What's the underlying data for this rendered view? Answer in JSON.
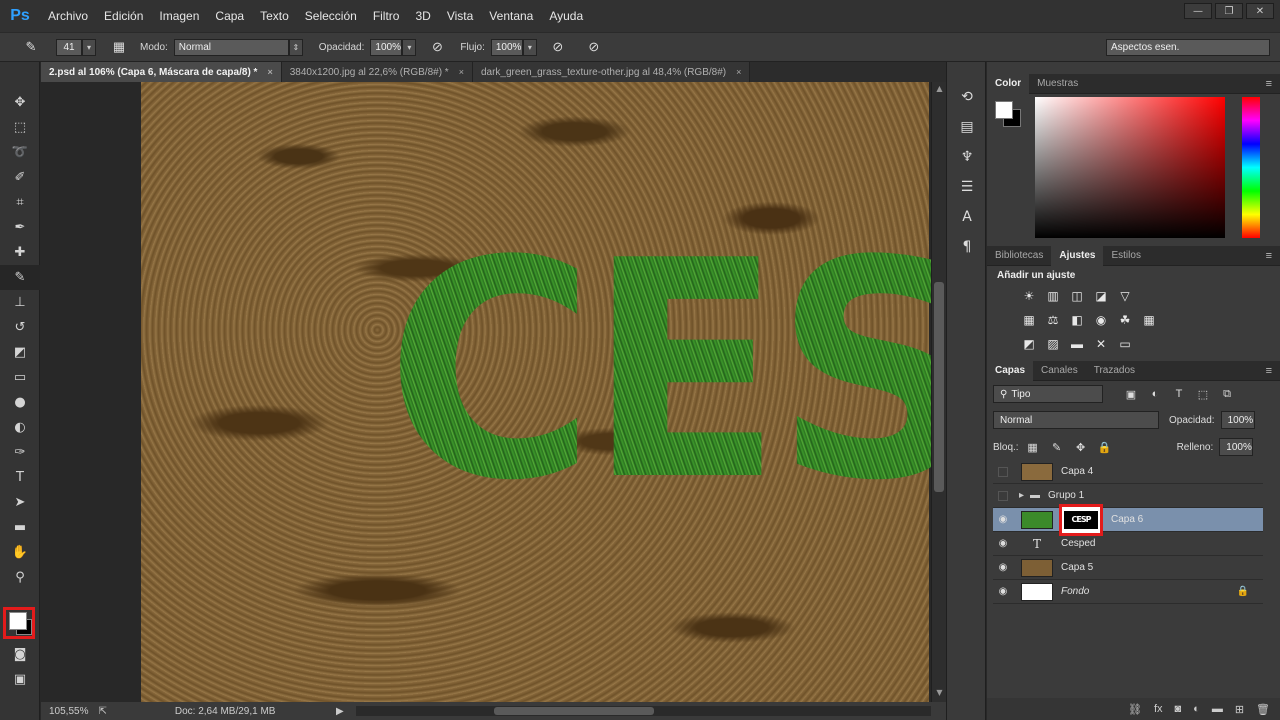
{
  "app": {
    "logo": "Ps"
  },
  "menu": [
    "Archivo",
    "Edición",
    "Imagen",
    "Capa",
    "Texto",
    "Selección",
    "Filtro",
    "3D",
    "Vista",
    "Ventana",
    "Ayuda"
  ],
  "window_controls": {
    "minimize": "—",
    "restore": "❐",
    "close": "✕"
  },
  "options_bar": {
    "brush_size": "41",
    "mode_label": "Modo:",
    "mode_value": "Normal",
    "opacity_label": "Opacidad:",
    "opacity_value": "100%",
    "flow_label": "Flujo:",
    "flow_value": "100%",
    "workspace": "Aspectos esen."
  },
  "doc_tabs": [
    {
      "label": "2.psd al 106% (Capa 6, Máscara de capa/8) *",
      "close": "×"
    },
    {
      "label": "3840x1200.jpg al 22,6% (RGB/8#) *",
      "close": "×"
    },
    {
      "label": "dark_green_grass_texture-other.jpg al 48,4% (RGB/8#)",
      "close": "×"
    }
  ],
  "canvas": {
    "text": "CESP"
  },
  "status": {
    "zoom": "105,55%",
    "doc_info": "Doc: 2,64 MB/29,1 MB"
  },
  "color_panel": {
    "tabs": [
      "Color",
      "Muestras"
    ]
  },
  "adjust_panel": {
    "tabs": [
      "Bibliotecas",
      "Ajustes",
      "Estilos"
    ],
    "title": "Añadir un ajuste"
  },
  "layers_panel": {
    "tabs": [
      "Capas",
      "Canales",
      "Trazados"
    ],
    "filter": "Tipo",
    "blend_mode": "Normal",
    "opacity_label": "Opacidad:",
    "opacity_value": "100%",
    "lock_label": "Bloq.:",
    "fill_label": "Relleno:",
    "fill_value": "100%",
    "layers": [
      {
        "name": "Capa 4",
        "visible": false
      },
      {
        "name": "Grupo 1",
        "visible": false
      },
      {
        "name": "Capa 6",
        "visible": true,
        "mask_text": "CESP"
      },
      {
        "name": "Cesped",
        "visible": true
      },
      {
        "name": "Capa 5",
        "visible": true
      },
      {
        "name": "Fondo",
        "visible": true
      }
    ]
  },
  "colors": {
    "highlight": "#e31b1b",
    "selected_layer": "#7a90ac",
    "accent": "#2fa0ff"
  }
}
